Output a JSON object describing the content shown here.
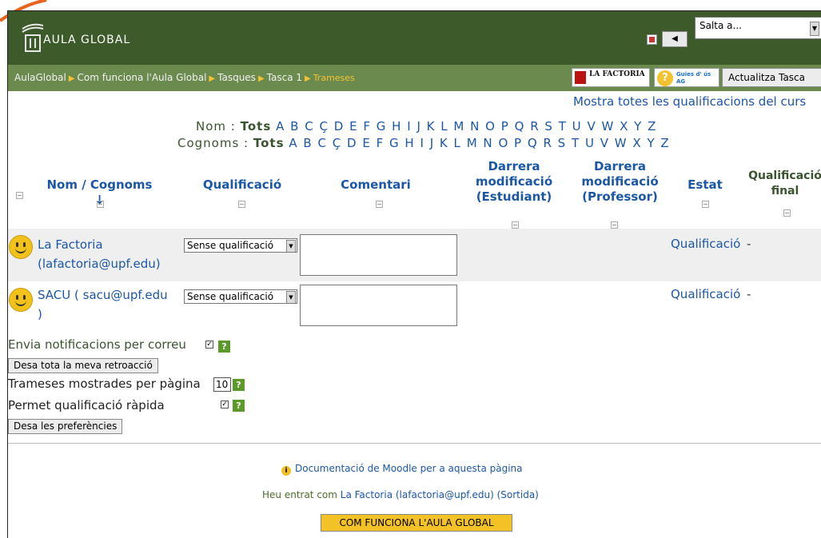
{
  "header": {
    "site_name": "AULA GLOBAL",
    "jump_select": "Salta a..."
  },
  "nav": {
    "breadcrumbs": [
      "AulaGlobal",
      "Com funciona l'Aula Global",
      "Tasques",
      "Tasca 1"
    ],
    "current": "Trameses",
    "badge_factoria": "LA FACTORIA",
    "badge_guies": "Guies d' ús AG",
    "update_button": "Actualitza Tasca"
  },
  "show_all_link": "Mostra totes les qualificacions del curs",
  "filters": {
    "first_name_label": "Nom :",
    "last_name_label": "Cognoms :",
    "all": "Tots",
    "letters": [
      "A",
      "B",
      "C",
      "Ç",
      "D",
      "E",
      "F",
      "G",
      "H",
      "I",
      "J",
      "K",
      "L",
      "M",
      "N",
      "O",
      "P",
      "Q",
      "R",
      "S",
      "T",
      "U",
      "V",
      "W",
      "X",
      "Y",
      "Z"
    ]
  },
  "table": {
    "headers": {
      "name": "Nom / Cognoms ↓",
      "grade": "Qualificació",
      "comment": "Comentari",
      "last_student": "Darrera modificació (Estudiant)",
      "last_teacher": "Darrera modificació (Professor)",
      "status": "Estat",
      "final_grade": "Qualificació final"
    },
    "rows": [
      {
        "name_line1": "La Factoria",
        "name_line2": "(lafactoria@upf.edu)",
        "grade": "Sense qualificació",
        "status": "Qualificació",
        "final": "-"
      },
      {
        "name_line1": "SACU ( sacu@upf.edu",
        "name_line2": ")",
        "grade": "Sense qualificació",
        "status": "Qualificació",
        "final": "-"
      }
    ]
  },
  "preferences": {
    "notify_label": "Envia notificacions per correu",
    "notify_checked": true,
    "save_feedback_button": "Desa tota la meva retroacció",
    "per_page_label": "Trameses mostrades per pàgina",
    "per_page_value": "10",
    "quick_grading_label": "Permet qualificació ràpida",
    "quick_grading_checked": true,
    "save_prefs_button": "Desa les preferències",
    "help_glyph": "?"
  },
  "footer": {
    "doc_link": "Documentació de Moodle per a aquesta pàgina",
    "login_prefix": "Heu entrat com ",
    "login_user": "La Factoria (lafactoria@upf.edu)",
    "logout": "(Sortida)",
    "course_button": "COM FUNCIONA L'AULA GLOBAL"
  },
  "colors": {
    "header_bg": "#3d5a2a",
    "nav_bg": "#6b8a4e",
    "link": "#1c57a5",
    "accent": "#f4c232"
  }
}
